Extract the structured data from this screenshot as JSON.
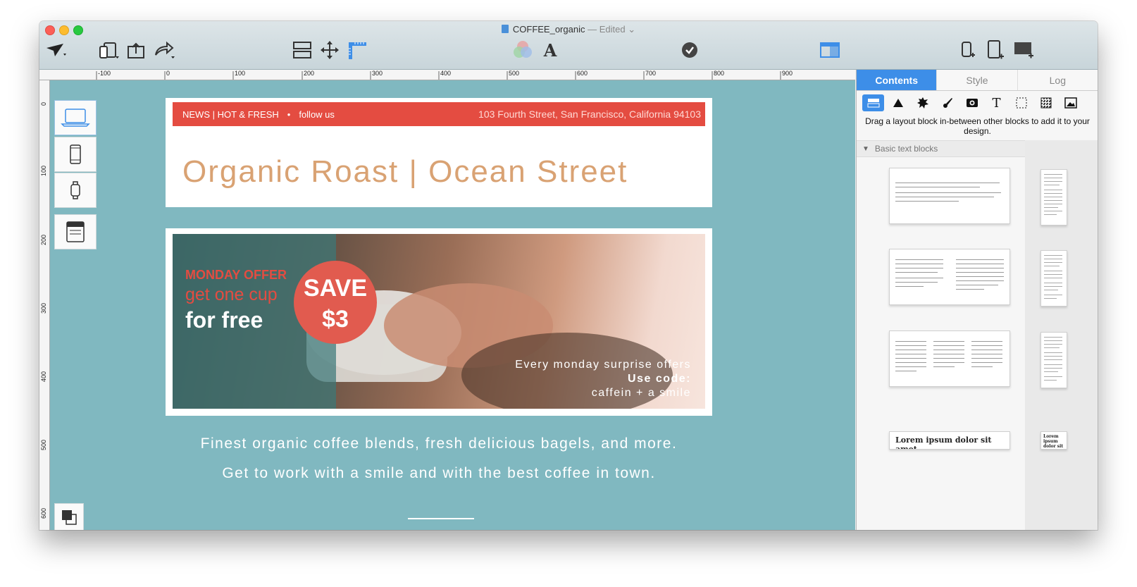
{
  "window": {
    "title": "COFFEE_organic",
    "status": "— Edited",
    "chevron": "⌄"
  },
  "ruler": {
    "top_labels": [
      "-100",
      "0",
      "100",
      "200",
      "300",
      "400",
      "500",
      "600",
      "700",
      "800",
      "900"
    ],
    "left_labels": [
      "0",
      "100",
      "200",
      "300",
      "400",
      "500",
      "600"
    ]
  },
  "email": {
    "topbar_left": "NEWS | HOT & FRESH",
    "topbar_dot": "•",
    "topbar_follow": "follow us",
    "topbar_address": "103 Fourth Street, San Francisco, California 94103",
    "headline": "Organic Roast | Ocean Street",
    "offer_line1": "MONDAY OFFER",
    "offer_line2": "get one cup",
    "offer_line3": "for free",
    "save_line1": "SAVE",
    "save_line2": "$3",
    "promo_line1": "Every monday surprise offers",
    "promo_line2": "Use code:",
    "promo_line3": "caffein + a smile",
    "body_line1_pre": "Finest ",
    "body_line1_bold": "organic coffee",
    "body_line1_post": " blends, fresh delicious bagels, and more.",
    "body_line2": "Get to work with a smile and with the best coffee in town."
  },
  "panel": {
    "tabs": [
      "Contents",
      "Style",
      "Log"
    ],
    "active_tab": "Contents",
    "hint": "Drag a layout block in-between other blocks to add it to your design.",
    "section_title": "Basic text blocks",
    "lorem_large": "Lorem ipsum dolor sit amet",
    "lorem_small": "Lorem ipsum dolor sit amet"
  },
  "colors": {
    "accent": "#3d8ee8",
    "canvas": "#80b8c0",
    "red": "#e44c41",
    "headline": "#d9a273"
  },
  "icons": [
    "send-icon",
    "devices-icon",
    "upload-icon",
    "share-icon",
    "layout-icon",
    "move-icon",
    "ruler-icon",
    "color-icon",
    "font-icon",
    "check-icon",
    "preview-icon",
    "phone-add-icon",
    "tablet-add-icon",
    "desktop-add-icon"
  ]
}
